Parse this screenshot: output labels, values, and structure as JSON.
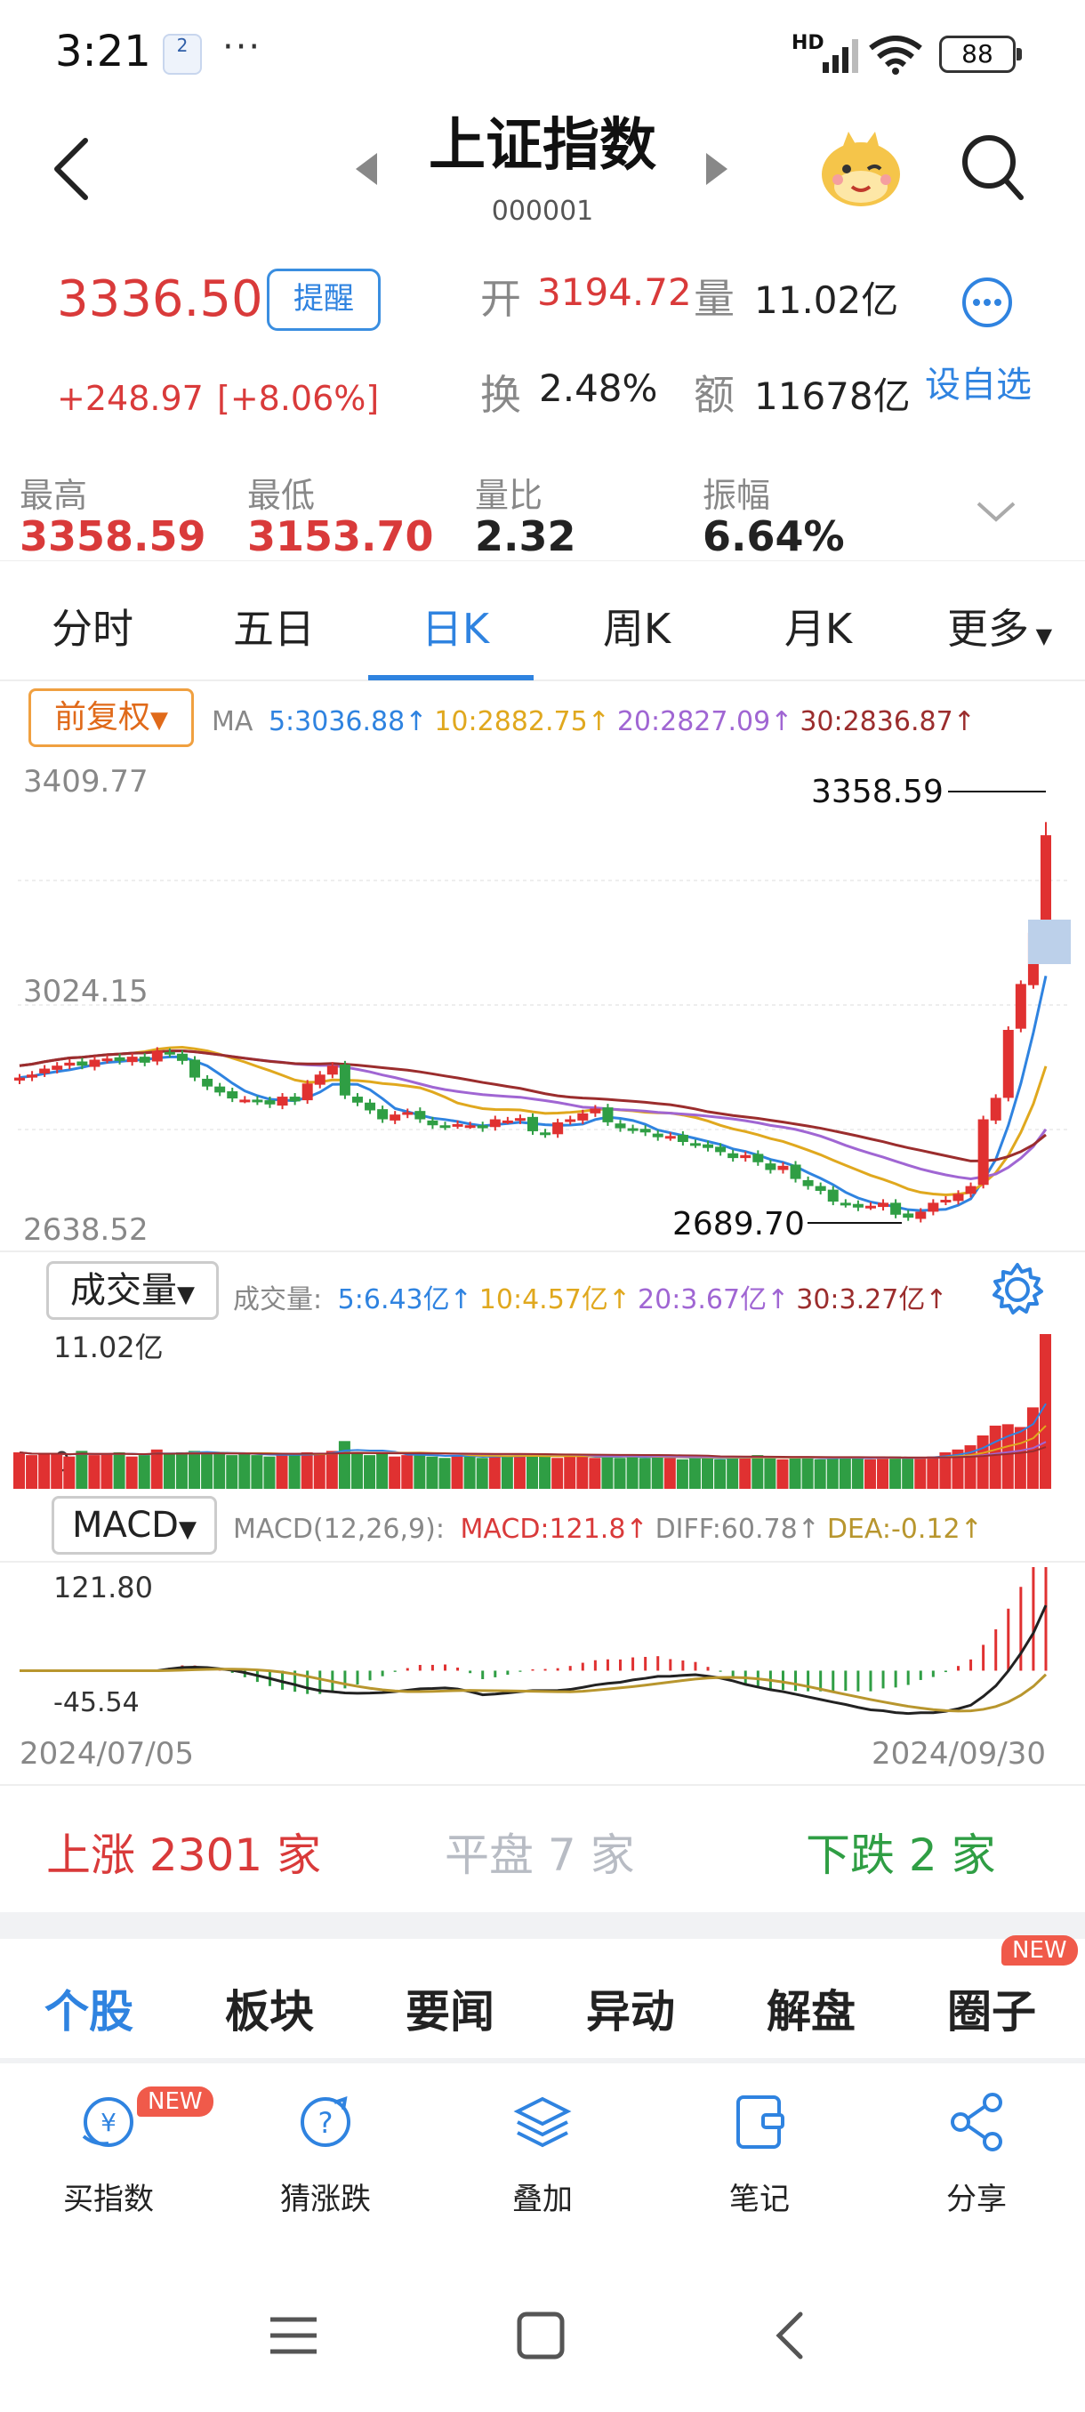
{
  "status_bar": {
    "time": "3:21",
    "badge": "2",
    "dots": "···",
    "signal_label": "HD",
    "battery": "88"
  },
  "header": {
    "title": "上证指数",
    "code": "000001"
  },
  "quote": {
    "price": "3336.50",
    "remind_label": "提醒",
    "change": "+248.97",
    "change_pct": "[+8.06%]",
    "open_label": "开",
    "open_value": "3194.72",
    "volume_label": "量",
    "volume_value": "11.02亿",
    "turnover_label": "换",
    "turnover_value": "2.48%",
    "amount_label": "额",
    "amount_value": "11678亿",
    "add_watch_label": "设自选"
  },
  "stats": [
    {
      "label": "最高",
      "value": "3358.59",
      "color": "#d93a3a"
    },
    {
      "label": "最低",
      "value": "3153.70",
      "color": "#d93a3a"
    },
    {
      "label": "量比",
      "value": "2.32",
      "color": "#222222"
    },
    {
      "label": "振幅",
      "value": "6.64%",
      "color": "#222222"
    }
  ],
  "tabs": [
    "分时",
    "五日",
    "日K",
    "周K",
    "月K",
    "更多"
  ],
  "active_tab": 2,
  "ma_bar": {
    "adjust_label": "前复权",
    "ma_label": "MA",
    "items": [
      {
        "text": "5:3036.88↑",
        "color": "#2f83e0"
      },
      {
        "text": "10:2882.75↑",
        "color": "#e0a81e"
      },
      {
        "text": "20:2827.09↑",
        "color": "#a066d3"
      },
      {
        "text": "30:2836.87↑",
        "color": "#9b2d2d"
      }
    ]
  },
  "kline": {
    "y_top": "3409.77",
    "y_mid": "3024.15",
    "y_bottom": "2638.52",
    "high_label": "3358.59",
    "low_label": "2689.70"
  },
  "volume_bar": {
    "selector_label": "成交量",
    "prefix": "成交量:",
    "items": [
      {
        "text": "5:6.43亿↑",
        "color": "#2f83e0"
      },
      {
        "text": "10:4.57亿↑",
        "color": "#e0a81e"
      },
      {
        "text": "20:3.67亿↑",
        "color": "#a066d3"
      },
      {
        "text": "30:3.27亿↑",
        "color": "#9b2d2d"
      }
    ],
    "y_top": "11.02亿",
    "y_zero": "0"
  },
  "macd_bar": {
    "selector_label": "MACD",
    "prefix": "MACD(12,26,9):",
    "items": [
      {
        "text": "MACD:121.8↑",
        "color": "#d93a3a"
      },
      {
        "text": "DIFF:60.78↑",
        "color": "#888888"
      },
      {
        "text": "DEA:-0.12↑",
        "color": "#b8962e"
      }
    ],
    "y_top": "121.80",
    "y_low": "-45.54"
  },
  "date_axis": {
    "start": "2024/07/05",
    "end": "2024/09/30"
  },
  "breadth": {
    "up_label": "上涨",
    "up_count": "2301",
    "up_unit": "家",
    "flat_label": "平盘",
    "flat_count": "7",
    "flat_unit": "家",
    "down_label": "下跌",
    "down_count": "2",
    "down_unit": "家"
  },
  "content_tabs": [
    "个股",
    "板块",
    "要闻",
    "异动",
    "解盘",
    "圈子"
  ],
  "content_active": 0,
  "new_badge": "NEW",
  "bottom_actions": [
    {
      "label": "买指数",
      "icon": "buy-index-icon"
    },
    {
      "label": "猜涨跌",
      "icon": "guess-icon"
    },
    {
      "label": "叠加",
      "icon": "layers-icon"
    },
    {
      "label": "笔记",
      "icon": "note-icon"
    },
    {
      "label": "分享",
      "icon": "share-icon"
    }
  ],
  "chart_data": [
    {
      "type": "candlestick",
      "title": "",
      "x_range": [
        "2024/07/05",
        "2024/09/30"
      ],
      "ylim": [
        2638.52,
        3409.77
      ],
      "high": 3358.59,
      "low": 2689.7,
      "close": [
        2930,
        2935,
        2945,
        2950,
        2955,
        2950,
        2960,
        2962,
        2958,
        2965,
        2955,
        2975,
        2970,
        2958,
        2930,
        2915,
        2905,
        2895,
        2893,
        2890,
        2885,
        2898,
        2890,
        2920,
        2935,
        2950,
        2900,
        2888,
        2875,
        2860,
        2868,
        2872,
        2860,
        2850,
        2848,
        2852,
        2850,
        2845,
        2860,
        2858,
        2862,
        2840,
        2835,
        2855,
        2860,
        2870,
        2878,
        2855,
        2845,
        2842,
        2838,
        2830,
        2832,
        2822,
        2818,
        2812,
        2805,
        2795,
        2800,
        2788,
        2775,
        2782,
        2760,
        2748,
        2740,
        2722,
        2718,
        2712,
        2715,
        2720,
        2700,
        2695,
        2705,
        2720,
        2725,
        2735,
        2748,
        2860,
        2896,
        3010,
        3087,
        3173,
        3336.5
      ],
      "series": [
        {
          "name": "MA5",
          "value": 3036.88
        },
        {
          "name": "MA10",
          "value": 2882.75
        },
        {
          "name": "MA20",
          "value": 2827.09
        },
        {
          "name": "MA30",
          "value": 2836.87
        }
      ]
    },
    {
      "type": "bar",
      "title": "成交量",
      "ylim": [
        0,
        11.02
      ],
      "unit": "亿",
      "values": [
        2.6,
        2.4,
        2.5,
        2.5,
        2.3,
        2.7,
        2.4,
        2.5,
        2.6,
        2.3,
        2.4,
        2.8,
        2.5,
        2.6,
        2.7,
        2.5,
        2.6,
        2.4,
        2.5,
        2.4,
        2.3,
        2.5,
        2.4,
        2.6,
        2.5,
        2.7,
        3.4,
        2.6,
        2.4,
        2.5,
        2.3,
        2.4,
        2.5,
        2.3,
        2.2,
        2.4,
        2.3,
        2.2,
        2.4,
        2.3,
        2.4,
        2.5,
        2.3,
        2.2,
        2.3,
        2.4,
        2.2,
        2.3,
        2.2,
        2.4,
        2.2,
        2.3,
        2.2,
        2.1,
        2.3,
        2.2,
        2.1,
        2.3,
        2.2,
        2.4,
        2.2,
        2.1,
        2.3,
        2.2,
        2.1,
        2.2,
        2.3,
        2.2,
        2.1,
        2.2,
        2.3,
        2.2,
        2.2,
        2.3,
        2.6,
        2.8,
        3.1,
        3.8,
        4.5,
        4.6,
        4.4,
        5.8,
        11.02
      ],
      "series": [
        {
          "name": "MA5",
          "value": 6.43
        },
        {
          "name": "MA10",
          "value": 4.57
        },
        {
          "name": "MA20",
          "value": 3.67
        },
        {
          "name": "MA30",
          "value": 3.27
        }
      ]
    },
    {
      "type": "bar",
      "title": "MACD(12,26,9)",
      "ylim": [
        -45.54,
        121.8
      ],
      "MACD": 121.8,
      "DIFF": 60.78,
      "DEA": -0.12
    }
  ]
}
